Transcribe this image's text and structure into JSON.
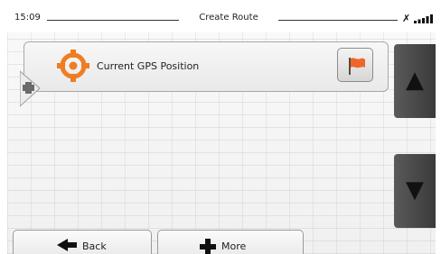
{
  "status_bar": {
    "time": "15:09",
    "title": "Create Route"
  },
  "route": {
    "items": [
      {
        "label": "Current GPS Position",
        "icon": "gps-target-icon"
      }
    ]
  },
  "scroll": {
    "up_label": "▲",
    "down_label": "▼"
  },
  "bottom_bar": {
    "back_label": "Back",
    "more_label": "More"
  },
  "colors": {
    "gps_icon": "#f07d22",
    "flag": "#f0652a",
    "scroll_button": "#4a4a4a"
  }
}
